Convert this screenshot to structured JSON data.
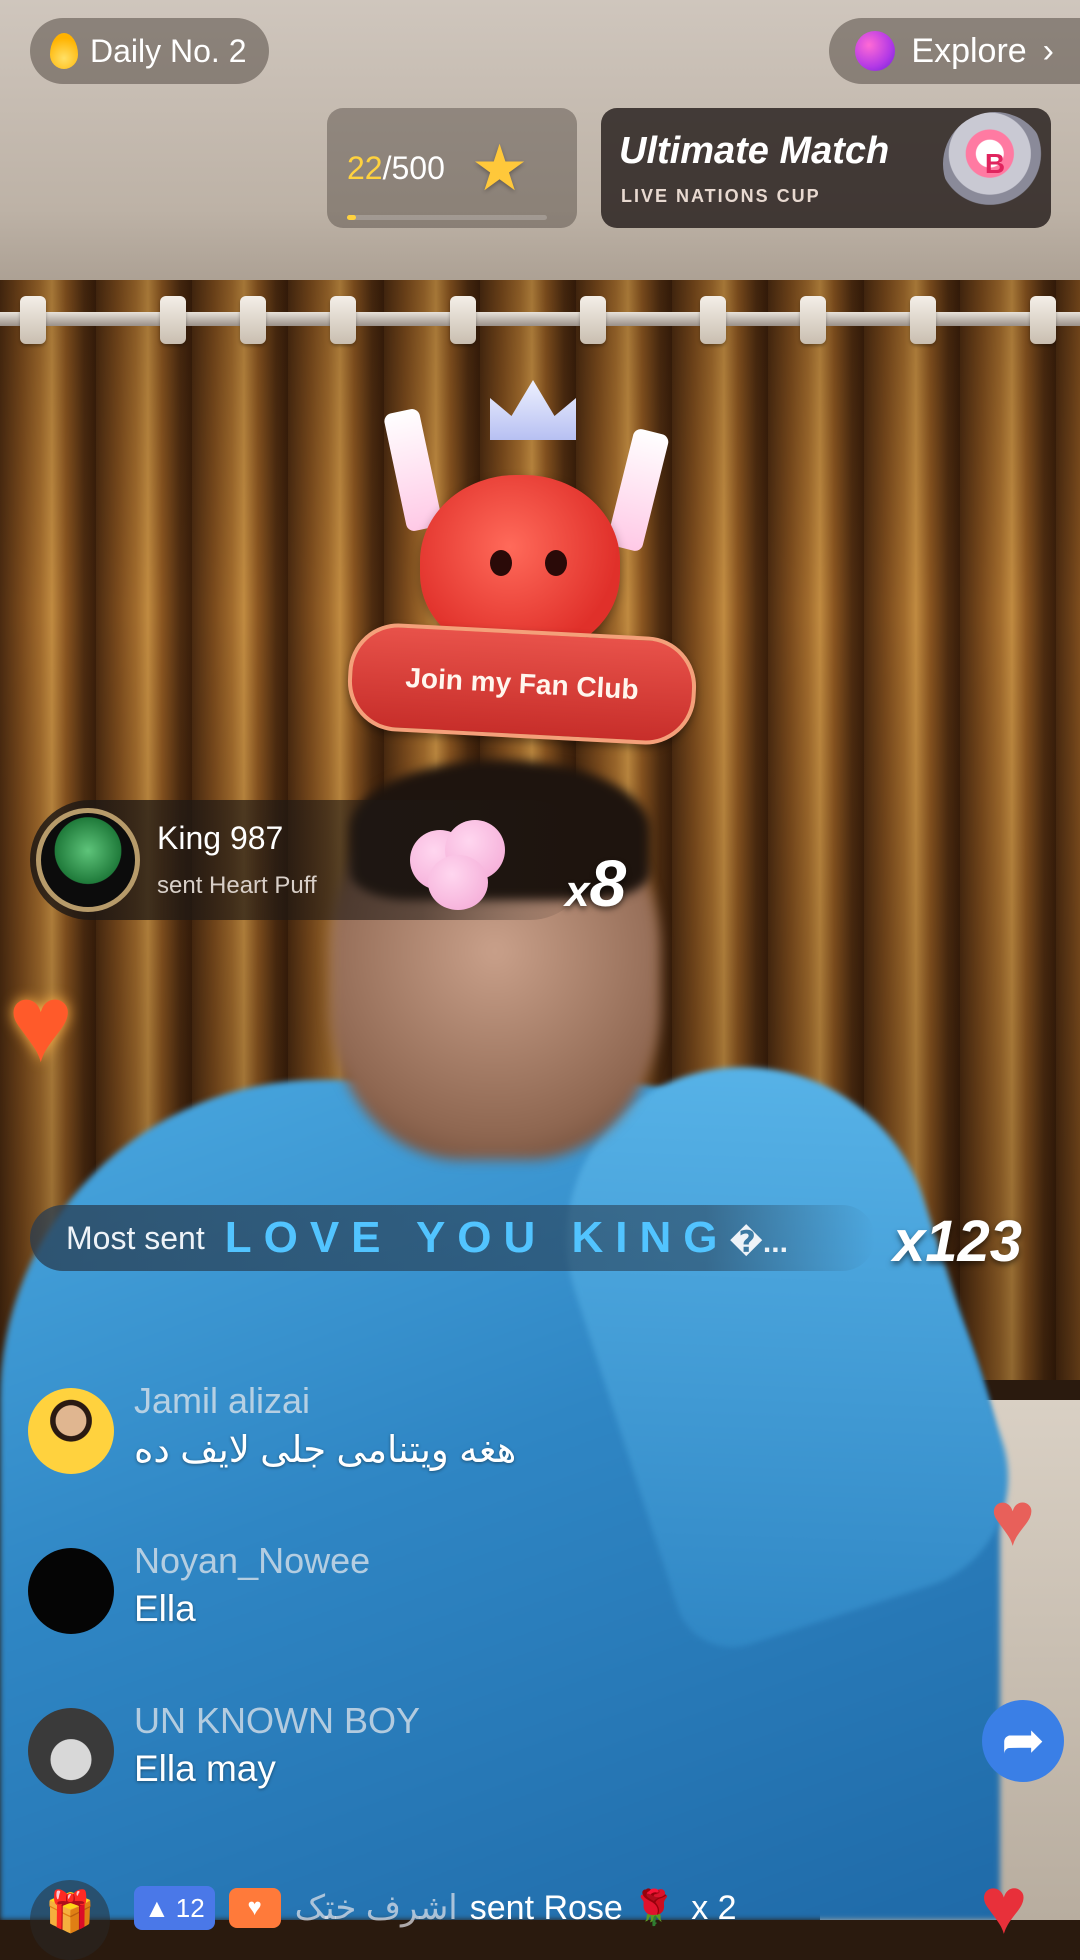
{
  "top": {
    "daily_label": "Daily No. 2",
    "explore_label": "Explore",
    "progress": {
      "current": "22",
      "total": "/500",
      "fraction": 0.044
    },
    "match": {
      "title": "Ultimate Match",
      "subtitle": "LIVE NATIONS CUP",
      "badge": "B"
    }
  },
  "fan_club": {
    "label": "Join my Fan Club"
  },
  "gift_notification": {
    "user": "King 987",
    "text": "sent Heart Puff",
    "multiplier": "8",
    "multiplier_prefix": "x"
  },
  "most_sent": {
    "label": "Most sent",
    "gift_text": "LOVE YOU KING",
    "ellipsis": "�...",
    "multiplier": "x123"
  },
  "comments": [
    {
      "user": "Jamil alizai",
      "message": "هغه ویتنامی جلی لایف ده"
    },
    {
      "user": "Noyan_Nowee",
      "message": "Ella"
    },
    {
      "user": "UN KNOWN BOY",
      "message": "Ella may"
    }
  ],
  "bottom": {
    "level": "12",
    "sender_name": "اشرف ختک",
    "sent_text": "sent Rose",
    "count": "x 2"
  },
  "colors": {
    "accent_blue": "#52c4ff",
    "progress_yellow": "#ffd23e",
    "share_blue": "#3a7fe6"
  }
}
